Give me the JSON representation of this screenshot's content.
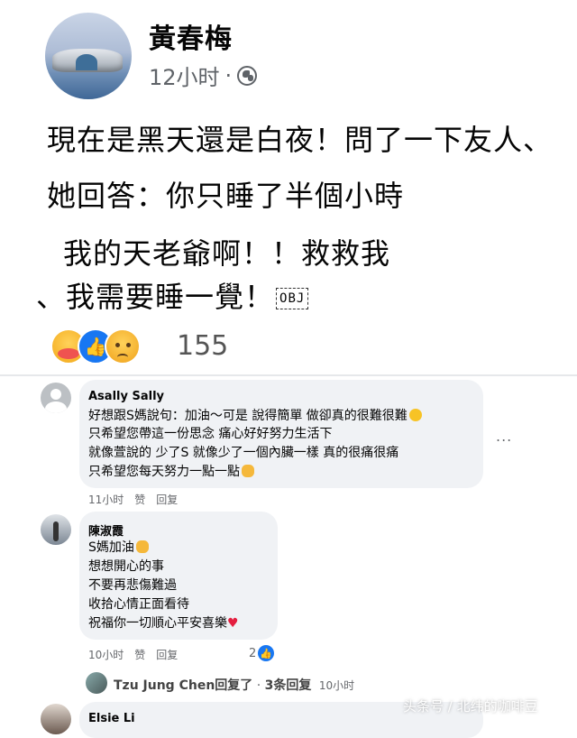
{
  "post": {
    "author": "黃春梅",
    "time": "12小时",
    "sep": "·",
    "lines": [
      "現在是黑天還是白夜！問了一下友人、",
      "她回答：你只睡了半個小時",
      "我的天老爺啊！！救救我",
      "、我需要睡一覺！"
    ],
    "obj_marker": "OBJ",
    "reaction_count": "155"
  },
  "comments": [
    {
      "name": "Asally Sally",
      "lines": [
        "好想跟S媽說句：加油～可是 說得簡單 做卻真的很難很難",
        "只希望您帶這一份思念 痛心好好努力生活下",
        "就像萱說的 少了S 就像少了一個內臟一樣 真的很痛很痛",
        "只希望您每天努力一點一點"
      ],
      "more": "...",
      "time": "11小时",
      "like": "赞",
      "reply": "回复"
    },
    {
      "name": "陳淑霞",
      "lines": [
        "S媽加油",
        "想想開心的事",
        "不要再悲傷難過",
        "收拾心情正面看待",
        "祝福你一切順心平安喜樂"
      ],
      "heart": "♥",
      "time": "10小时",
      "like": "赞",
      "reply": "回复",
      "like_count": "2"
    }
  ],
  "reply_summary": {
    "name": "Tzu Jung Chen",
    "action": "回复了",
    "dot": " · ",
    "count": "3条回复",
    "time": "10小时"
  },
  "peek_comment": {
    "name": "Elsie Li"
  },
  "watermark": "头条号 / 北纬的咖啡豆",
  "colors": {
    "like_blue": "#1877f2",
    "bubble": "#f0f2f5",
    "meta_gray": "#65676b"
  }
}
